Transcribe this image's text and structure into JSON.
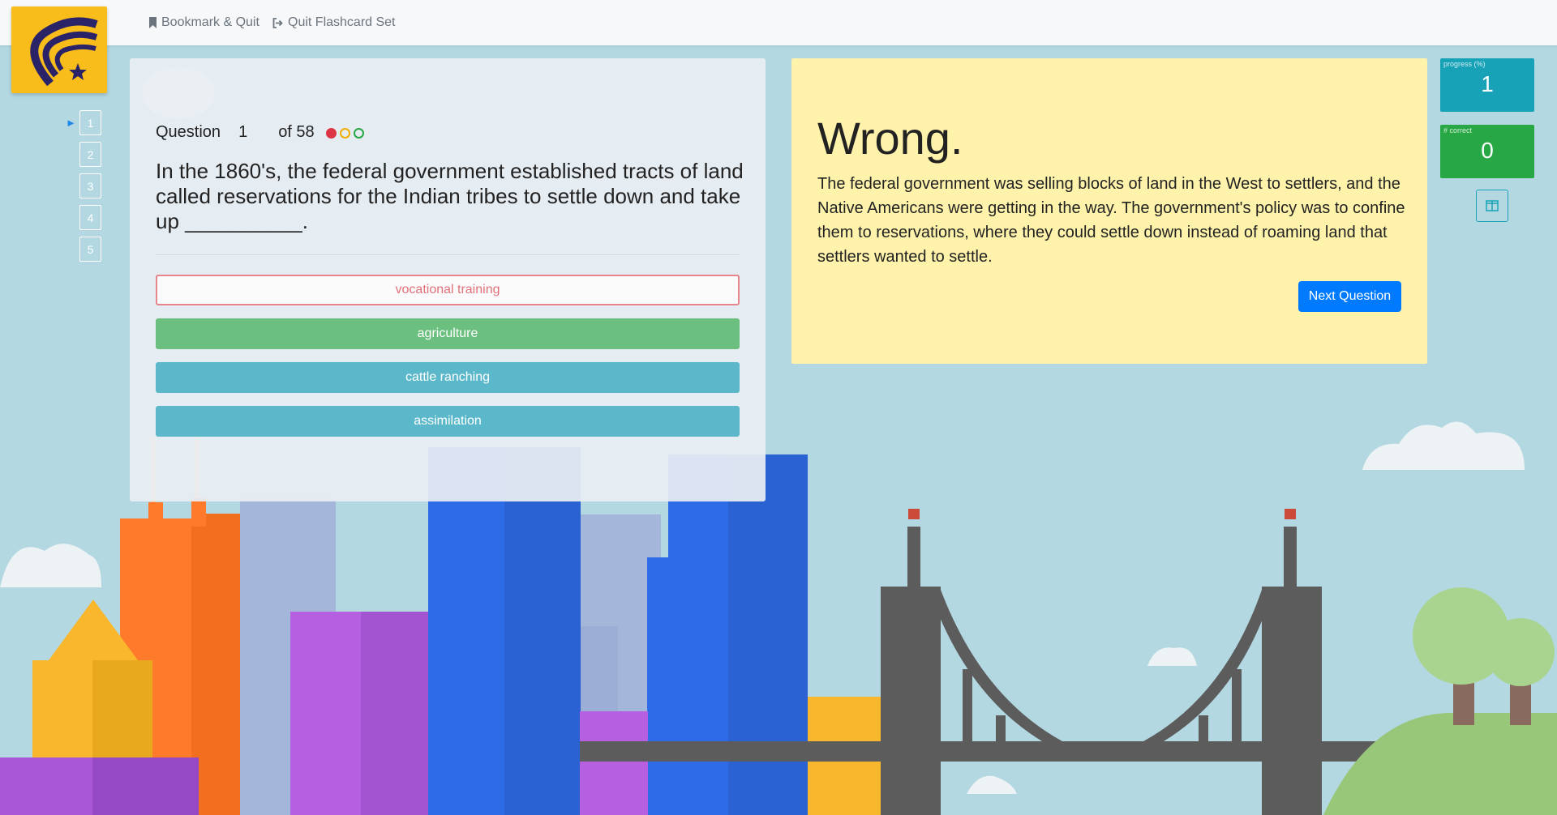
{
  "nav": {
    "bookmark_label": "Bookmark & Quit",
    "quit_label": "Quit Flashcard Set"
  },
  "question_nav": [
    "1",
    "2",
    "3",
    "4",
    "5"
  ],
  "question": {
    "label": "Question",
    "number": "1",
    "of_total": "of 58",
    "text": "In the 1860's, the federal government established tracts of land called reservations for the Indian tribes to settle down and take up __________.",
    "dot_colors": [
      "#dc3545",
      "#f0ad00",
      "#28a745"
    ]
  },
  "answers": [
    {
      "label": "vocational training",
      "state": "wrong"
    },
    {
      "label": "agriculture",
      "state": "correct"
    },
    {
      "label": "cattle ranching",
      "state": "neutral"
    },
    {
      "label": "assimilation",
      "state": "neutral"
    }
  ],
  "feedback": {
    "title": "Wrong.",
    "text": "The federal government was selling blocks of land in the West to settlers, and the Native Americans were getting in the way. The government's policy was to confine them to reservations, where they could settle down instead of roaming land that settlers wanted to settle.",
    "next_label": "Next Question"
  },
  "stats": {
    "progress_label": "progress (%)",
    "progress_value": "1",
    "correct_label": "# correct",
    "correct_value": "0"
  },
  "colors": {
    "brand_yellow": "#f8bd1b",
    "feedback_bg": "#fff3ac",
    "correct": "#6bbf7f",
    "neutral": "#5bb8cb",
    "wrong": "#dc3545",
    "primary": "#007bff",
    "stat_progress": "#17a2b8",
    "stat_correct": "#28a745"
  }
}
